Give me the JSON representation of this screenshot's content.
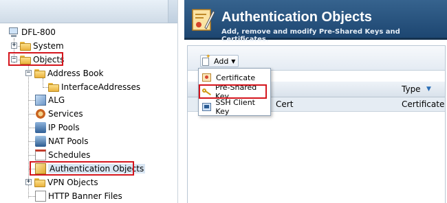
{
  "tree": {
    "items": [
      {
        "label": "DFL-800"
      },
      {
        "label": "System"
      },
      {
        "label": "Objects"
      },
      {
        "label": "Address Book"
      },
      {
        "label": "InterfaceAddresses"
      },
      {
        "label": "ALG"
      },
      {
        "label": "Services"
      },
      {
        "label": "IP Pools"
      },
      {
        "label": "NAT Pools"
      },
      {
        "label": "Schedules"
      },
      {
        "label": "Authentication Objects"
      },
      {
        "label": "VPN Objects"
      },
      {
        "label": "HTTP Banner Files"
      }
    ],
    "highlight_color": "#d4141c"
  },
  "header": {
    "title": "Authentication Objects",
    "subtitle": "Add, remove and modify Pre-Shared Keys and Certificates."
  },
  "toolbar": {
    "add_label": "Add"
  },
  "add_menu": {
    "items": [
      {
        "label": "Certificate",
        "icon": "certificate-icon"
      },
      {
        "label": "Pre-Shared Key",
        "icon": "key-icon"
      },
      {
        "label": "SSH Client Key",
        "icon": "ssh-key-icon"
      }
    ]
  },
  "grid": {
    "columns": [
      {
        "label": "Type"
      }
    ],
    "rows": [
      {
        "name": "Cert",
        "type": "Certificate"
      }
    ]
  },
  "colors": {
    "title_bar": "#1d4671",
    "highlight": "#d4141c",
    "selection": "#d9e6f3"
  }
}
